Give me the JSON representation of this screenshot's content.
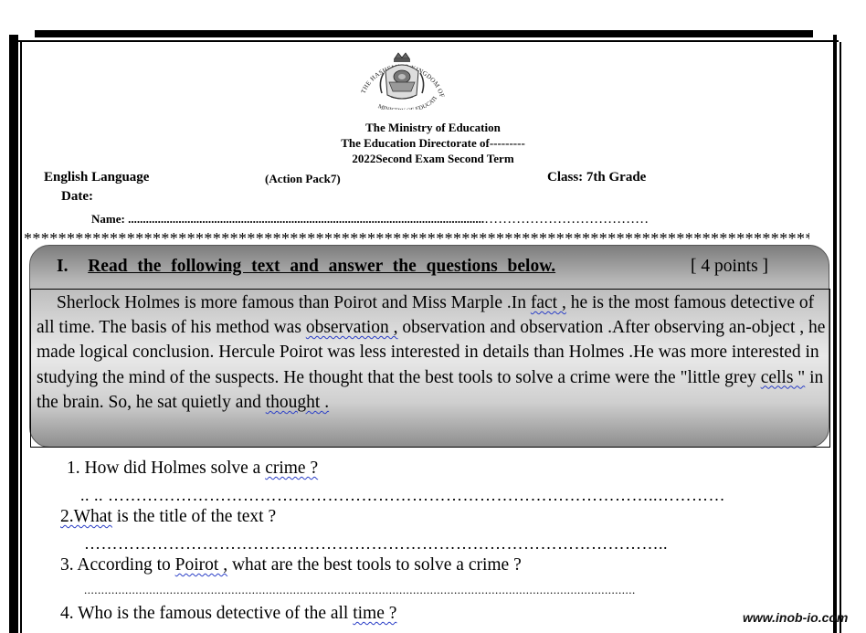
{
  "header": {
    "emblem_text": "THE HASHEMITE KINGDOM OF JORDAN · MINISTRY OF EDUCATION",
    "line1": "The Ministry of Education",
    "line2": "The Education Directorate of---------",
    "line3": "2022Second   Exam Second Term",
    "subject": "English  Language",
    "book": "(Action Pack7)",
    "class": "Class: 7th Grade",
    "date_label": "Date:",
    "name_label": "Name: ........................................................................................................................",
    "name_dots": "………………………………",
    "divider": "*********************************************************************************************************"
  },
  "section": {
    "number": "I.",
    "title": "Read the following text and answer the questions below.",
    "points": "[  4 points  ]"
  },
  "passage": {
    "seg1": "Sherlock Holmes is more famous than Poirot and Miss Marple .In ",
    "w1": "fact ,",
    "seg2": " he is the most famous detective of all time. The basis of his method was ",
    "w2": "observation ,",
    "seg3": " observation and observation .After observing an-object , he made logical conclusion. Hercule Poirot was less interested in details than Holmes .He was more interested in studying the mind of the suspects. He thought that the best tools to solve a crime were the \"little grey ",
    "w3": "cells \"",
    "seg4": " in the brain. So, he sat quietly and ",
    "w4": "thought ."
  },
  "questions": {
    "q1_pre": "1. How did Holmes solve a ",
    "q1_w": "crime ?",
    "q1_dots": ".. .. ……………………………………………………………………………………..…………",
    "q2_w": " 2.What",
    "q2_post": " is the title of the text  ?",
    "q2_dots": "…………………………………………………………………………………………..",
    "q3_pre": "3. According to ",
    "q3_w": "Poirot ,",
    "q3_post": " what are the best tools to solve a crime ?",
    "q3_dots": ".................................................................................................................................................................",
    "q4_pre": "4. Who is the famous detective of the all ",
    "q4_w": "time ?"
  },
  "watermark": "www.inob-io.com"
}
